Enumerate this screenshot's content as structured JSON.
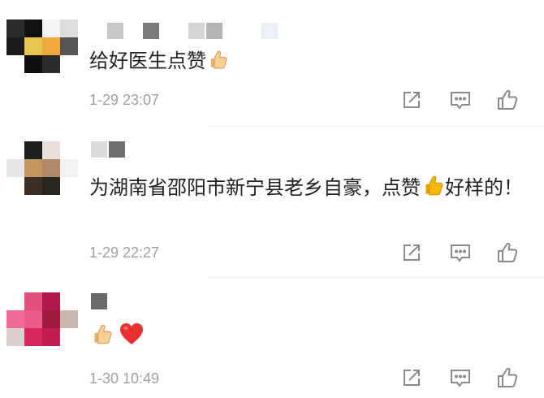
{
  "comments": [
    {
      "text": "给好医生点赞",
      "emojis": [
        "thumbs-up"
      ],
      "timestamp": "1-29 23:07"
    },
    {
      "text": "为湖南省邵阳市新宁县老乡自豪，点赞",
      "text_after_emoji": "好样的！",
      "emojis": [
        "thumbs-up"
      ],
      "timestamp": "1-29 22:27"
    },
    {
      "text": "",
      "emojis": [
        "thumbs-up",
        "red-heart"
      ],
      "timestamp": "1-30 10:49"
    }
  ],
  "actions": [
    {
      "icon": "share-icon"
    },
    {
      "icon": "reply-icon"
    },
    {
      "icon": "like-icon"
    }
  ],
  "colors": {
    "text": "#222222",
    "timestamp": "#a0a0a0",
    "icon": "#8a8a8a",
    "thumb": "#f2c27a",
    "thumb_yellow": "#f5b800",
    "heart": "#e8302f"
  }
}
